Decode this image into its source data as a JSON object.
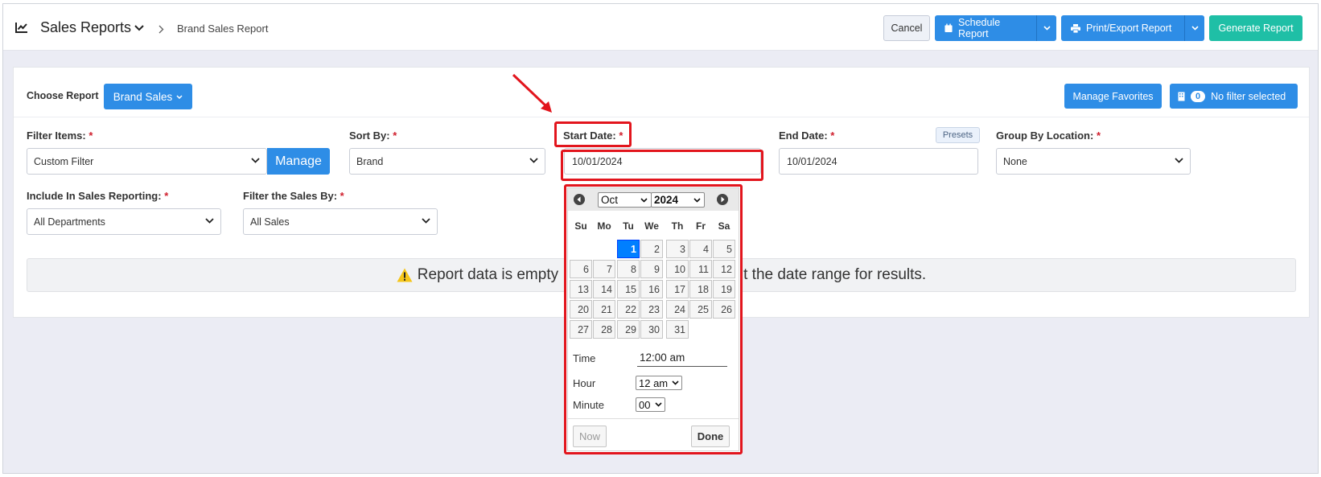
{
  "header": {
    "title": "Sales Reports",
    "breadcrumb": "Brand Sales Report",
    "cancel_label": "Cancel",
    "schedule_label": "Schedule Report",
    "print_label": "Print/Export Report",
    "generate_label": "Generate Report"
  },
  "report": {
    "choose_label": "Choose Report",
    "choose_value": "Brand Sales",
    "manage_favorites_label": "Manage Favorites",
    "filter_count": "0",
    "filter_status": "No filter selected"
  },
  "filters": {
    "filter_items_label": "Filter Items:",
    "filter_items_value": "Custom Filter",
    "manage_label": "Manage",
    "sort_by_label": "Sort By:",
    "sort_by_value": "Brand",
    "start_date_label": "Start Date:",
    "start_date_value": "10/01/2024",
    "end_date_label": "End Date:",
    "end_date_value": "10/01/2024",
    "presets_label": "Presets",
    "group_by_label": "Group By Location:",
    "group_by_value": "None",
    "include_label": "Include In Sales Reporting:",
    "include_value": "All Departments",
    "filter_sales_label": "Filter the Sales By:",
    "filter_sales_value": "All Sales",
    "required_mark": "*"
  },
  "alert": {
    "text_left": "Report data is empty",
    "text_right": "t the date range for results."
  },
  "calendar": {
    "month": "Oct",
    "year": "2024",
    "weekdays": [
      "Su",
      "Mo",
      "Tu",
      "We",
      "Th",
      "Fr",
      "Sa"
    ],
    "days": [
      "1",
      "2",
      "3",
      "4",
      "5",
      "6",
      "7",
      "8",
      "9",
      "10",
      "11",
      "12",
      "13",
      "14",
      "15",
      "16",
      "17",
      "18",
      "19",
      "20",
      "21",
      "22",
      "23",
      "24",
      "25",
      "26",
      "27",
      "28",
      "29",
      "30",
      "31"
    ],
    "selected_day": "1",
    "time_label": "Time",
    "time_value": "12:00 am",
    "hour_label": "Hour",
    "hour_value": "12 am",
    "minute_label": "Minute",
    "minute_value": "00",
    "now_label": "Now",
    "done_label": "Done"
  },
  "colors": {
    "primary": "#2e8de6",
    "teal": "#1fbfa6",
    "annotation_red": "#e2151d",
    "selected_day": "#007fff"
  }
}
